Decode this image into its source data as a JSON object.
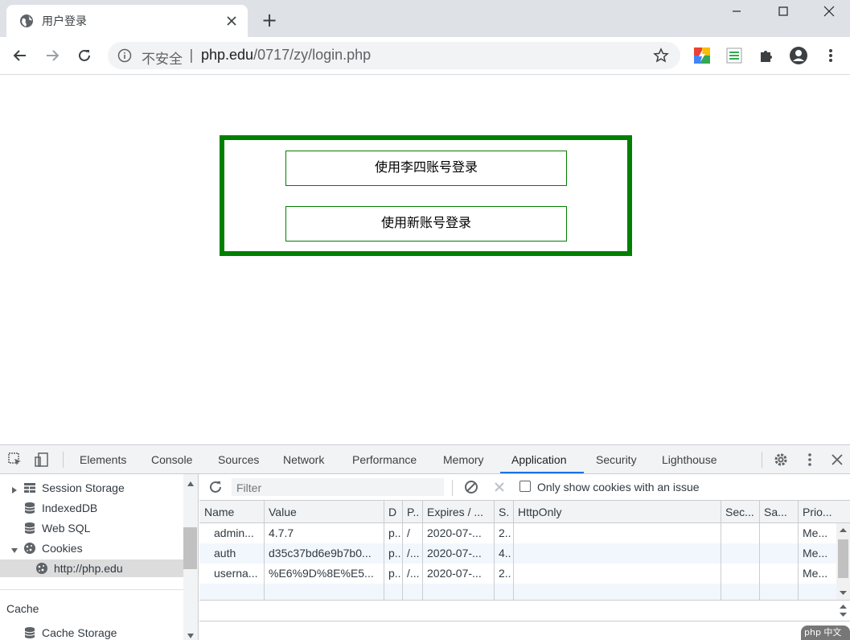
{
  "browser": {
    "tab_title": "用户登录",
    "new_tab": "+",
    "omnibox": {
      "security_label": "不安全",
      "separator": "|",
      "url_host": "php.edu",
      "url_path": "/0717/zy/login.php"
    }
  },
  "page": {
    "login_with_lisi": "使用李四账号登录",
    "login_with_new": "使用新账号登录"
  },
  "devtools": {
    "tabs": [
      "Elements",
      "Console",
      "Sources",
      "Network",
      "Performance",
      "Memory",
      "Application",
      "Security",
      "Lighthouse"
    ],
    "active_tab": "Application",
    "sidebar": {
      "session_storage": "Session Storage",
      "indexeddb": "IndexedDB",
      "web_sql": "Web SQL",
      "cookies": "Cookies",
      "cookie_origin": "http://php.edu",
      "cache_header": "Cache",
      "cache_storage": "Cache Storage"
    },
    "cookie_toolbar": {
      "filter_placeholder": "Filter",
      "only_issues_label": "Only show cookies with an issue"
    },
    "cookie_table": {
      "columns": [
        "Name",
        "Value",
        "D",
        "P..",
        "Expires / ...",
        "S.",
        "HttpOnly",
        "Sec...",
        "Sa...",
        "Prio..."
      ],
      "rows": [
        [
          "admin...",
          "4.7.7",
          "p..",
          "/",
          "2020-07-...",
          "2..",
          "",
          "",
          "",
          "Me..."
        ],
        [
          "auth",
          "d35c37bd6e9b7b0...",
          "p..",
          "/...",
          "2020-07-...",
          "4..",
          "",
          "",
          "",
          "Me..."
        ],
        [
          "userna...",
          "%E6%9D%8E%E5...",
          "p..",
          "/...",
          "2020-07-...",
          "2..",
          "",
          "",
          "",
          "Me..."
        ]
      ]
    }
  },
  "watermark": "php 中文网"
}
